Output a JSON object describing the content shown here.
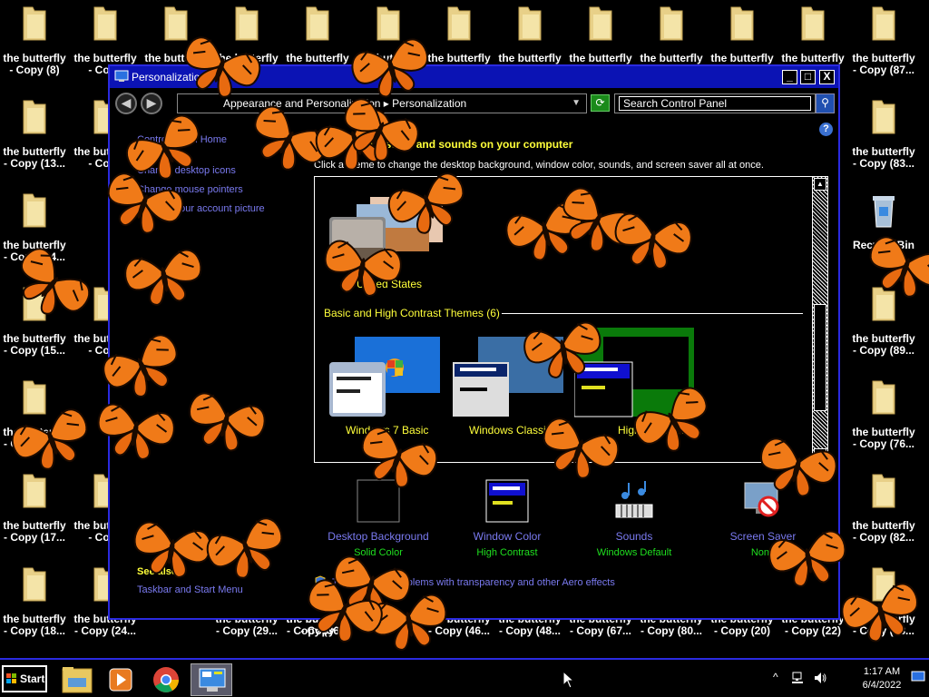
{
  "desktop": {
    "icons": [
      {
        "l1": "the butterfly",
        "l2": "- Copy (8)"
      },
      {
        "l1": "the butterfly",
        "l2": "- Copy"
      },
      {
        "l1": "the butterfly",
        "l2": "- Copy (13..."
      },
      {
        "l1": "the butterfly",
        "l2": "- Copy"
      },
      {
        "l1": "the butterfly",
        "l2": "- Copy (14..."
      },
      {
        "l1": "the butterfly",
        "l2": "- Copy (15..."
      },
      {
        "l1": "the butterfly",
        "l2": "- Copy"
      },
      {
        "l1": "the butterfly",
        "l2": "- Copy (16..."
      },
      {
        "l1": "the butterfly",
        "l2": "- Copy (17..."
      },
      {
        "l1": "the butterfly",
        "l2": "- Copy"
      },
      {
        "l1": "the butterfly",
        "l2": "- Copy (18..."
      },
      {
        "l1": "the butterfly",
        "l2": "- Copy (24..."
      },
      {
        "l1": "the butterfly",
        "l2": "- Copy (29..."
      },
      {
        "l1": "the butterfly",
        "l2": "- Copy (36..."
      },
      {
        "l1": "the butterfly",
        "l2": "- Copy"
      },
      {
        "l1": "the butterfly",
        "l2": "- Copy (46..."
      },
      {
        "l1": "the butterfly",
        "l2": "- Copy (48..."
      },
      {
        "l1": "the butterfly",
        "l2": "- Copy (67..."
      },
      {
        "l1": "the butterfly",
        "l2": "- Copy (80..."
      },
      {
        "l1": "the butterfly",
        "l2": "- Copy (20)"
      },
      {
        "l1": "the butterfly",
        "l2": "- Copy (22)"
      },
      {
        "l1": "the butterfly",
        "l2": "- Copy (88..."
      },
      {
        "l1": "the butterfly",
        "l2": "- Copy (87..."
      },
      {
        "l1": "the butterfly",
        "l2": "- Copy (83..."
      },
      {
        "l1": "Recycle Bin",
        "l2": ""
      },
      {
        "l1": "the butterfly",
        "l2": "- Copy (89..."
      },
      {
        "l1": "the butterfly",
        "l2": "- Copy (76..."
      },
      {
        "l1": "the butterfly",
        "l2": "- Copy (82..."
      }
    ],
    "top_row_label": "the butterfly"
  },
  "window": {
    "title": "Personalization",
    "minimize": "_",
    "maximize": "□",
    "close": "X",
    "breadcrumb": "Appearance and Personalization ▸ Personalization",
    "search_placeholder": "Search Control Panel",
    "help": "?",
    "tasks": {
      "home": "Control Panel Home",
      "desktop_icons": "Change desktop icons",
      "mouse_pointers": "Change mouse pointers",
      "account_picture": "Change your account picture"
    },
    "heading": "Change the visuals and sounds on your computer",
    "subheading": "Click a theme to change the desktop background, window color, sounds, and screen saver all at once.",
    "my_theme_label": "United States",
    "section_label": "Basic and High Contrast Themes (6)",
    "themes": [
      {
        "label": "Windows 7 Basic"
      },
      {
        "label": "Windows Classic"
      },
      {
        "label": "High Contrast"
      }
    ],
    "bottom": [
      {
        "title": "Desktop Background",
        "value": "Solid Color"
      },
      {
        "title": "Window Color",
        "value": "High Contrast"
      },
      {
        "title": "Sounds",
        "value": "Windows Default"
      },
      {
        "title": "Screen Saver",
        "value": "None"
      }
    ],
    "see_also": "See also",
    "taskbar_link": "Taskbar and Start Menu",
    "troubleshoot": "Troubleshoot problems with transparency and other Aero effects"
  },
  "taskbar": {
    "start_label": "Start",
    "time": "1:17 AM",
    "date": "6/4/2022",
    "tray_up": "^"
  },
  "colors": {
    "accent_yellow": "#ffff3a",
    "link_blue": "#7a7af0",
    "status_green": "#1fe01f",
    "title_blue": "#0b13b4",
    "butterfly_orange": "#f07a18"
  }
}
